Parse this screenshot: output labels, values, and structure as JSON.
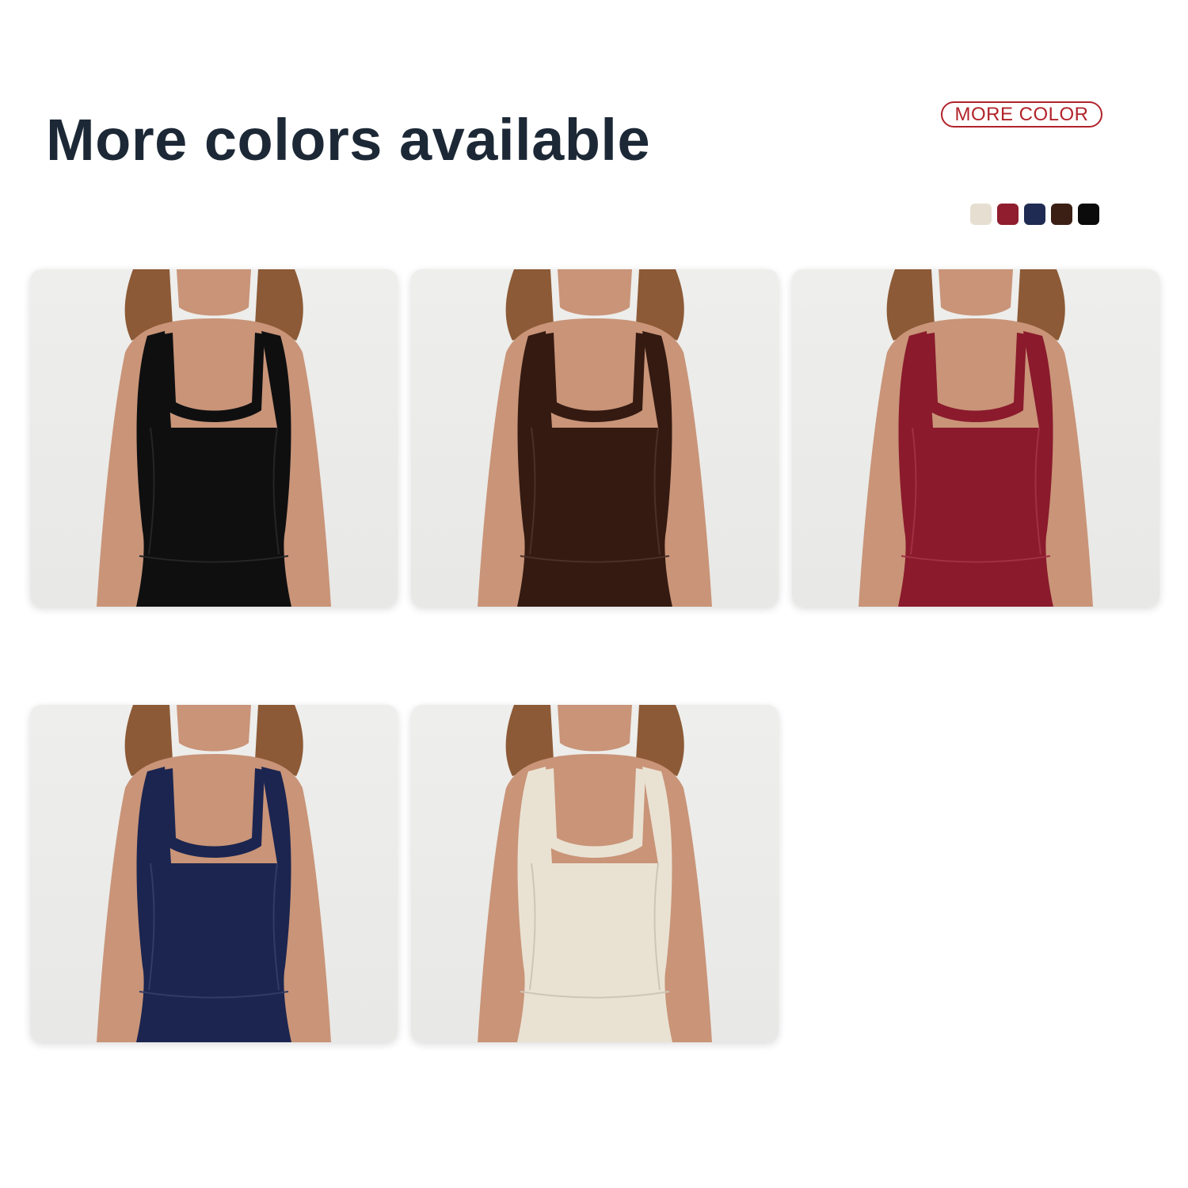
{
  "header": {
    "title": "More colors available",
    "badge_label": "MORE COLOR"
  },
  "swatches": [
    {
      "name": "beige-swatch",
      "color": "#e6dfd1"
    },
    {
      "name": "red-swatch",
      "color": "#8f1d2e"
    },
    {
      "name": "navy-swatch",
      "color": "#1f2b52"
    },
    {
      "name": "brown-swatch",
      "color": "#3b1f14"
    },
    {
      "name": "black-swatch",
      "color": "#0b0b0b"
    }
  ],
  "products": [
    {
      "name": "product-card-black",
      "color": "#0f0f10"
    },
    {
      "name": "product-card-brown",
      "color": "#341a11"
    },
    {
      "name": "product-card-red",
      "color": "#8a1a2c"
    },
    {
      "name": "product-card-navy",
      "color": "#1b2550"
    },
    {
      "name": "product-card-beige",
      "color": "#e9e2d3"
    }
  ],
  "skin_color": "#c99478",
  "hair_color": "#8c5a36"
}
